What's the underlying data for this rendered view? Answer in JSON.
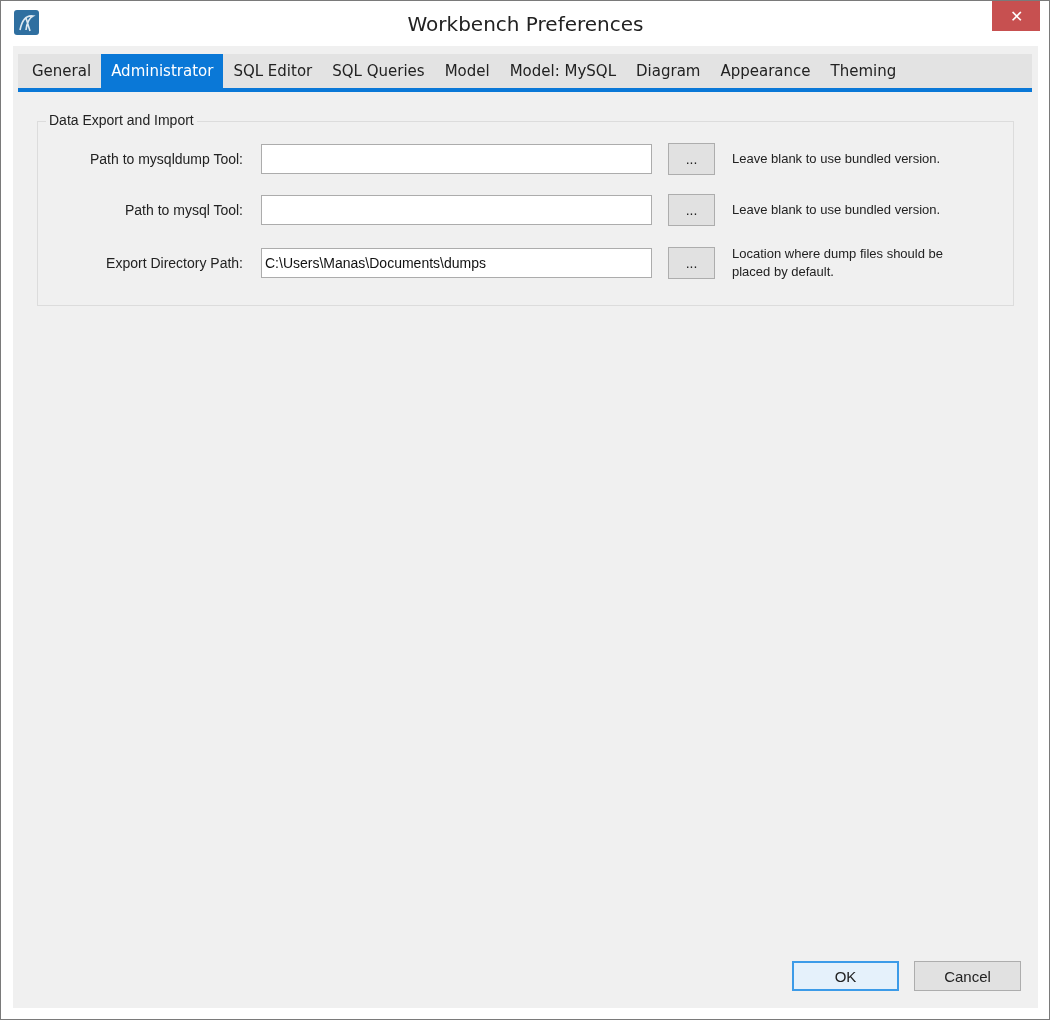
{
  "window": {
    "title": "Workbench Preferences",
    "close": "✕"
  },
  "tabs": [
    {
      "label": "General",
      "selected": false
    },
    {
      "label": "Administrator",
      "selected": true
    },
    {
      "label": "SQL Editor",
      "selected": false
    },
    {
      "label": "SQL Queries",
      "selected": false
    },
    {
      "label": "Model",
      "selected": false
    },
    {
      "label": "Model: MySQL",
      "selected": false
    },
    {
      "label": "Diagram",
      "selected": false
    },
    {
      "label": "Appearance",
      "selected": false
    },
    {
      "label": "Theming",
      "selected": false
    }
  ],
  "group": {
    "title": "Data Export and Import",
    "rows": [
      {
        "label": "Path to mysqldump Tool:",
        "browse": "...",
        "hint": "Leave blank to use bundled version."
      },
      {
        "label": "Path to mysql Tool:",
        "browse": "...",
        "hint": "Leave blank to use bundled version."
      },
      {
        "label": "Export Directory Path:",
        "value": "C:\\Users\\Manas\\Documents\\dumps",
        "browse": "...",
        "hint": "Location where dump files should be placed by default."
      }
    ]
  },
  "buttons": [
    {
      "label": "OK",
      "default": true
    },
    {
      "label": "Cancel",
      "default": false
    }
  ]
}
